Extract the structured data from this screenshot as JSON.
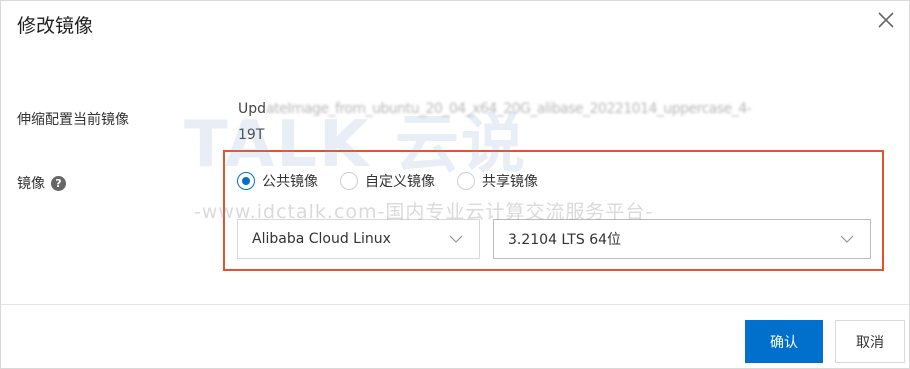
{
  "dialog": {
    "title": "修改镜像"
  },
  "form": {
    "scaling_label": "伸缩配置当前镜像",
    "current_image_prefix": "Upd",
    "current_image_blurred": "ateImage_from_ubuntu_20_04_x64_20G_alibase_20221014_uppercase_4-",
    "current_image_suffix": "19T",
    "image_label": "镜像",
    "help_icon_glyph": "?",
    "radios": [
      {
        "label": "公共镜像",
        "checked": true
      },
      {
        "label": "自定义镜像",
        "checked": false
      },
      {
        "label": "共享镜像",
        "checked": false
      }
    ],
    "os_select_value": "Alibaba Cloud Linux",
    "version_select_value": "3.2104 LTS 64位"
  },
  "footer": {
    "ok_label": "确认",
    "cancel_label": "取消"
  },
  "watermark": {
    "logo_text": "TALK 云说",
    "sub_text": "-www.idctalk.com-国内专业云计算交流服务平台-"
  },
  "colors": {
    "primary": "#0070cc",
    "highlight_border": "#e0542e"
  },
  "icons": {
    "close": "close-icon",
    "help": "help-icon",
    "chevron": "chevron-down-icon"
  }
}
